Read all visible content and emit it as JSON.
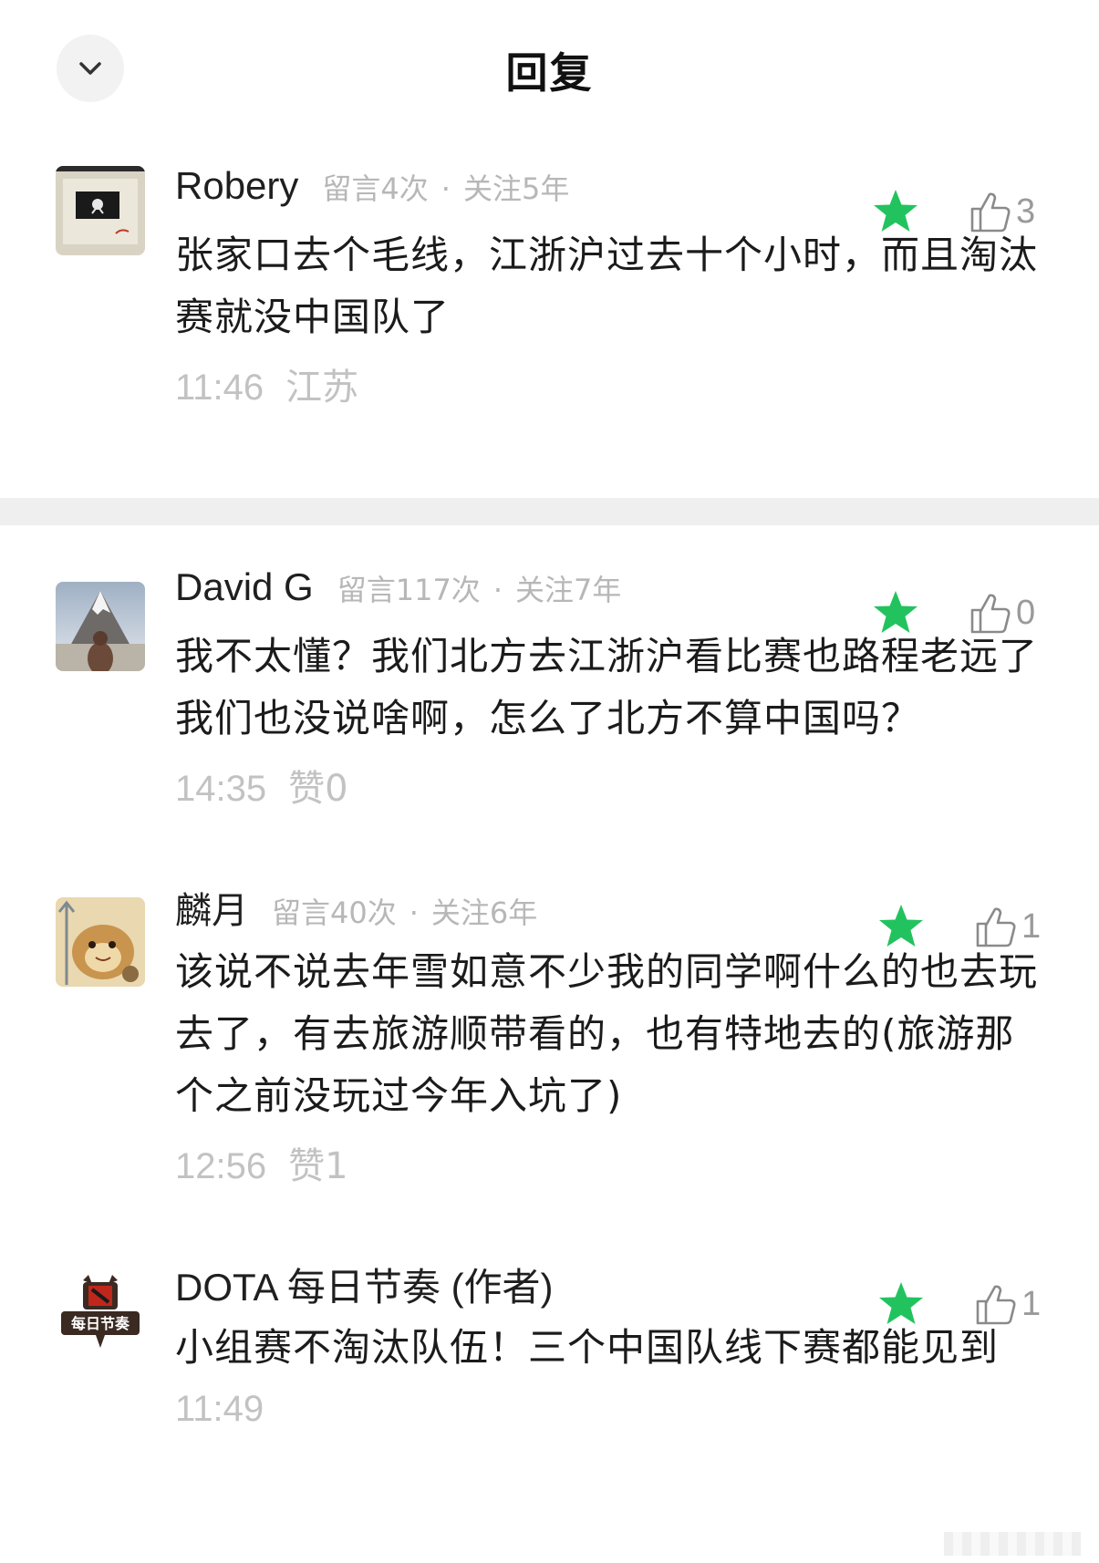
{
  "header": {
    "title": "回复",
    "back_icon": "chevron-down-icon"
  },
  "colors": {
    "star": "#22c35e",
    "meta_gray": "#b7b7b7",
    "divider": "#efefef"
  },
  "comments": [
    {
      "username": "Robery",
      "meta_messages": "留言4次",
      "meta_follow": "关注5年",
      "likes": "3",
      "content": "张家口去个毛线，江浙沪过去十个小时，而且淘汰赛就没中国队了",
      "time": "11:46",
      "extra": "江苏",
      "starred": true
    },
    {
      "username": "David G",
      "meta_messages": "留言117次",
      "meta_follow": "关注7年",
      "likes": "0",
      "content": "我不太懂？我们北方去江浙沪看比赛也路程老远了我们也没说啥啊，怎么了北方不算中国吗？",
      "time": "14:35",
      "extra": "赞0",
      "starred": true
    },
    {
      "username": "麟月",
      "meta_messages": "留言40次",
      "meta_follow": "关注6年",
      "likes": "1",
      "content": "该说不说去年雪如意不少我的同学啊什么的也去玩去了，有去旅游顺带看的，也有特地去的(旅游那个之前没玩过今年入坑了)",
      "time": "12:56",
      "extra": "赞1",
      "starred": true
    },
    {
      "username": "DOTA 每日节奏 (作者)",
      "meta_messages": "",
      "meta_follow": "",
      "likes": "1",
      "content": "小组赛不淘汰队伍！三个中国队线下赛都能见到",
      "time": "11:49",
      "extra": "",
      "starred": true,
      "avatar_logo_text": "每日节奏"
    }
  ]
}
